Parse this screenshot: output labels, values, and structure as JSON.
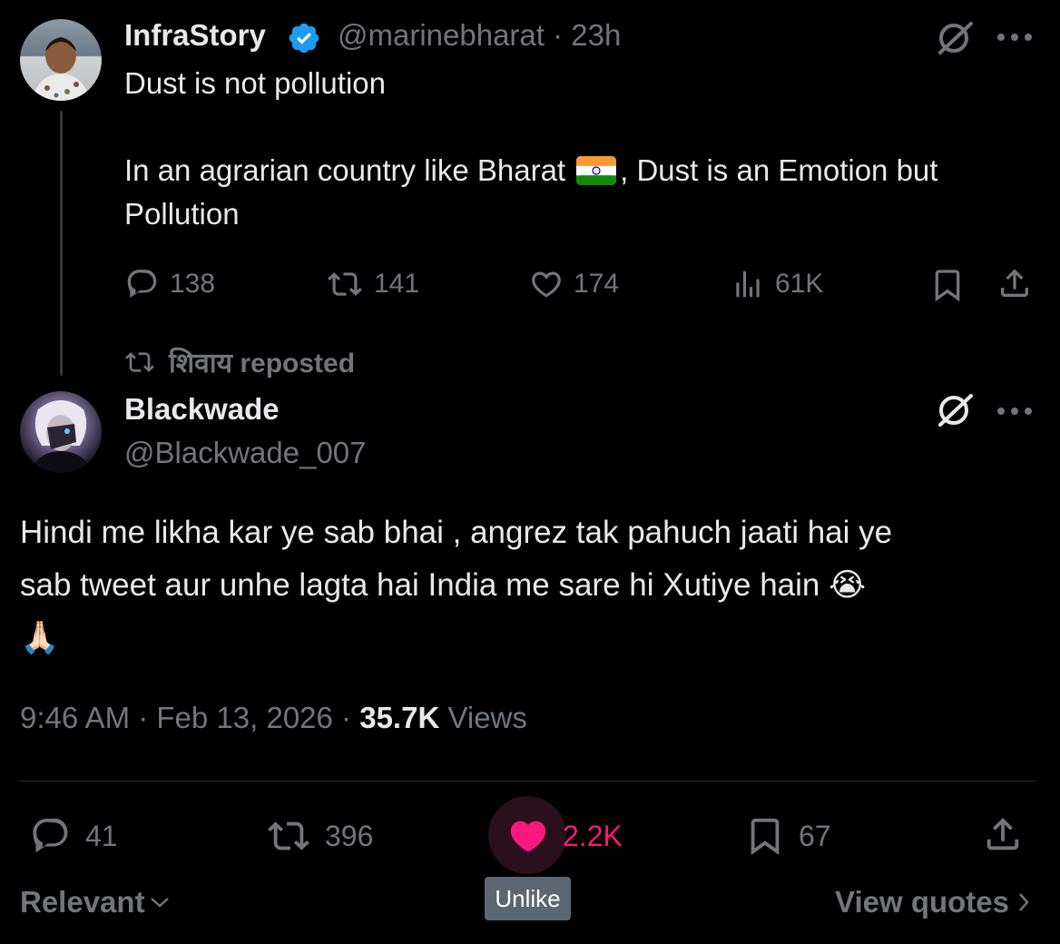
{
  "quoted_tweet": {
    "display_name": "InfraStory",
    "handle_time": "@marinebharat · 23h",
    "line1": "Dust is not pollution",
    "line2_before_flag": "In an agrarian country like Bharat",
    "line2_after_flag": ", Dust is an Emotion but",
    "line3": "Pollution",
    "replies": "138",
    "reposts": "141",
    "likes": "174",
    "views": "61K",
    "flag_icon": "india-flag-icon"
  },
  "repost_banner": {
    "text": "शिवाय reposted"
  },
  "main_tweet": {
    "display_name": "Blackwade",
    "handle": "@Blackwade_007",
    "text_line1": "Hindi me likha kar ye sab bhai , angrez tak pahuch jaati hai ye",
    "text_line2": "sab tweet aur unhe lagta hai India me sare hi Xutiye hain 😭",
    "text_line3": "🙏🏻",
    "time_date": "9:46 AM · Feb 13, 2026 · ",
    "views_count": "35.7K",
    "views_label": " Views",
    "replies": "41",
    "reposts": "396",
    "likes": "2.2K",
    "bookmarks": "67"
  },
  "tooltip": {
    "label": "Unlike"
  },
  "footer": {
    "sort_label": "Relevant",
    "view_quotes": "View quotes"
  },
  "colors": {
    "background": "#000000",
    "text_primary": "#e7e9ea",
    "text_secondary": "#71767b",
    "like_pink": "#f91880",
    "verified_blue": "#1d9bf0"
  }
}
